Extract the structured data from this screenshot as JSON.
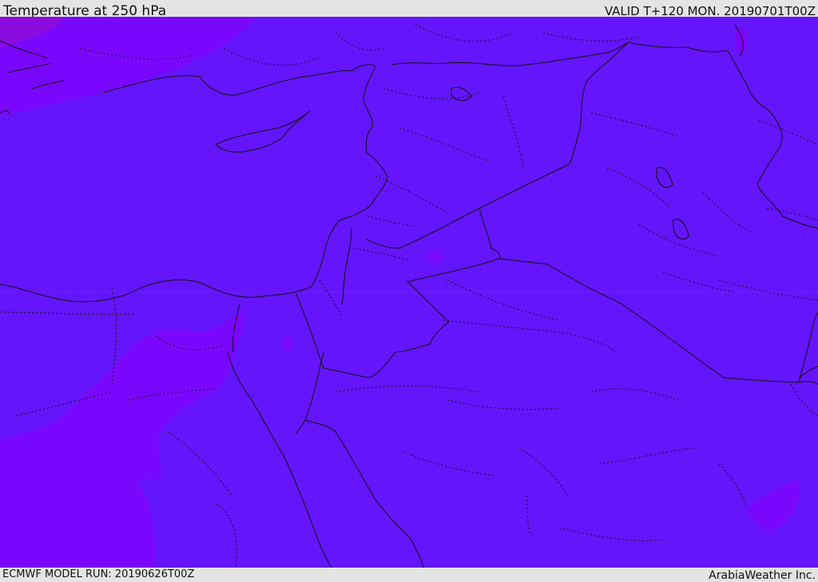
{
  "header": {
    "title": "Temperature at 250 hPa",
    "valid": "VALID T+120 MON. 20190701T00Z"
  },
  "footer": {
    "model_run": "ECMWF MODEL RUN: 20190626T00Z",
    "credit": "ArabiaWeather Inc."
  },
  "map": {
    "field": "temperature-250hPa",
    "colors": {
      "base_fill": "#6515fb",
      "warmer_patch": "#7a07fd",
      "darker_patch": "#8a0ce0",
      "coastline": "#111111",
      "border": "#111111"
    }
  }
}
